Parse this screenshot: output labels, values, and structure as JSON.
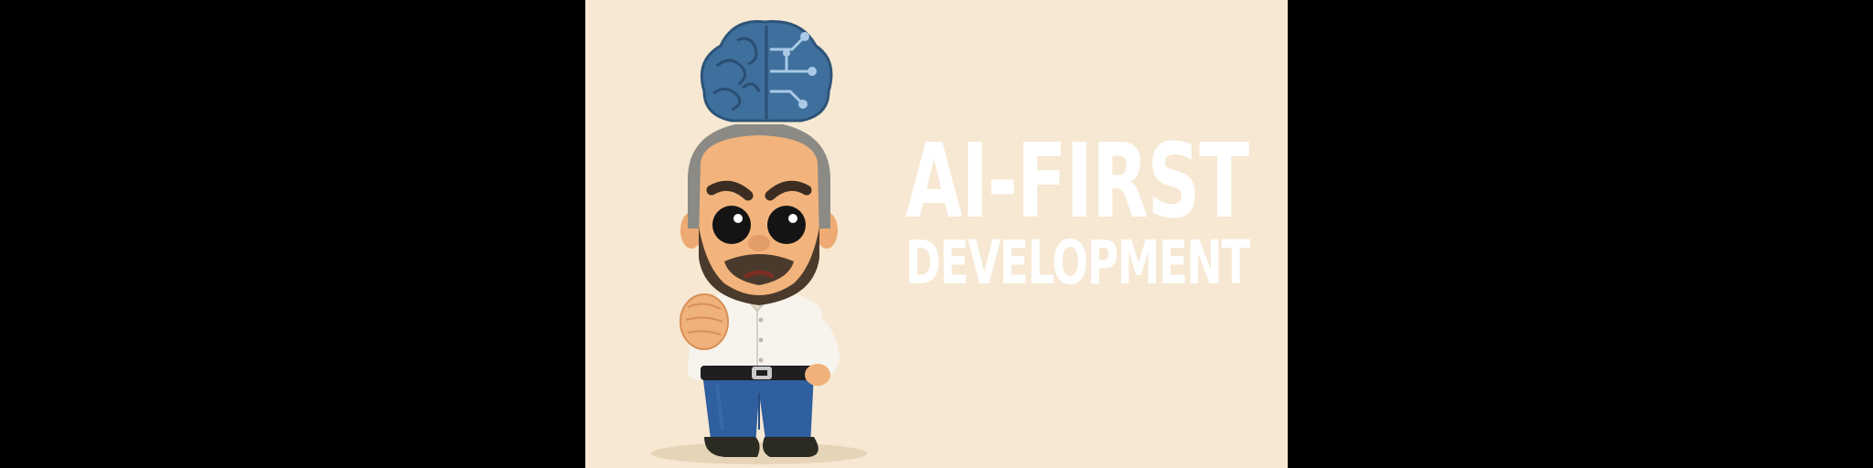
{
  "banner": {
    "background_color": "#f6e8d2",
    "letterbox_color": "#000000",
    "title_line1": "AI-FIRST",
    "title_line2": "DEVELOPMENT",
    "title_color": "#ffffff"
  },
  "illustration": {
    "character": "vinyl-figure-man-with-beard",
    "brain_color": "#3f6f9c",
    "shirt_color": "#f7f4ee",
    "jeans_color": "#2f5f9e"
  }
}
